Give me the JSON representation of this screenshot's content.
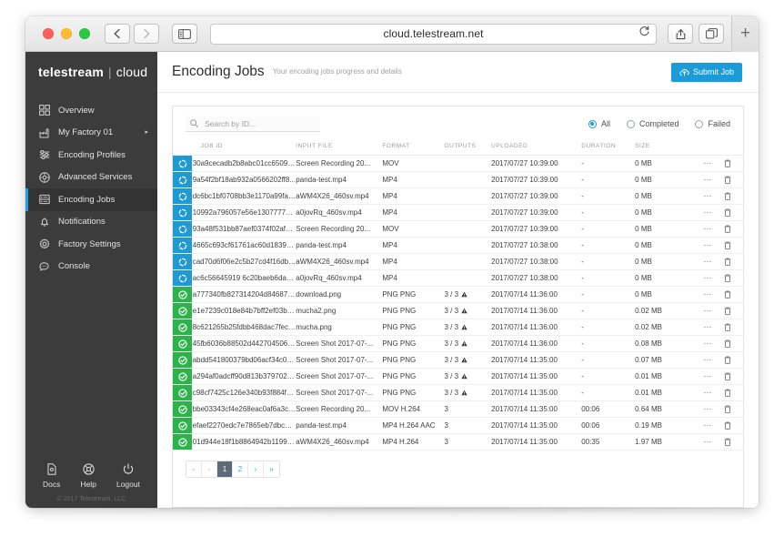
{
  "browser": {
    "url": "cloud.telestream.net",
    "back_label": "‹",
    "forward_label": "›",
    "sidebar_toggle_name": "sidebar-toggle",
    "reload_name": "reload-icon",
    "share_name": "share-icon",
    "tabs_name": "show-tabs-icon",
    "new_tab_label": "+"
  },
  "sidebar": {
    "brand": {
      "part1": "telestream",
      "divider": "|",
      "part2": "cloud"
    },
    "items": [
      {
        "label": "Overview",
        "icon": "grid-icon",
        "active": false,
        "caret": ""
      },
      {
        "label": "My Factory 01",
        "icon": "factory-icon",
        "active": false,
        "caret": "▸"
      },
      {
        "label": "Encoding Profiles",
        "icon": "sliders-icon",
        "active": false,
        "caret": ""
      },
      {
        "label": "Advanced Services",
        "icon": "gear-circle-icon",
        "active": false,
        "caret": ""
      },
      {
        "label": "Encoding Jobs",
        "icon": "server-icon",
        "active": true,
        "caret": ""
      },
      {
        "label": "Notifications",
        "icon": "bell-icon",
        "active": false,
        "caret": ""
      },
      {
        "label": "Factory Settings",
        "icon": "gear-icon",
        "active": false,
        "caret": ""
      },
      {
        "label": "Console",
        "icon": "chat-icon",
        "active": false,
        "caret": ""
      }
    ],
    "footer": [
      {
        "label": "Docs",
        "icon": "docs-icon"
      },
      {
        "label": "Help",
        "icon": "help-icon"
      },
      {
        "label": "Logout",
        "icon": "power-icon"
      }
    ],
    "copyright": "© 2017 Telestream, LLC"
  },
  "header": {
    "title": "Encoding Jobs",
    "subtitle": "Your encoding jobs progress and details",
    "submit_label": "Submit Job",
    "submit_icon": "cloud-upload-icon"
  },
  "filters": {
    "search_placeholder": "Search by ID...",
    "search_value": "",
    "search_icon": "search-icon",
    "radios": [
      {
        "label": "All",
        "selected": true
      },
      {
        "label": "Completed",
        "selected": false
      },
      {
        "label": "Failed",
        "selected": false
      }
    ]
  },
  "table": {
    "columns": [
      "",
      "JOB ID",
      "INPUT FILE",
      "FORMAT",
      "OUTPUTS",
      "UPLOADED",
      "DURATION",
      "SIZE",
      ""
    ],
    "rows": [
      {
        "status": "processing",
        "id": "30a9cecadb2b8abc01cc650928...",
        "input": "Screen Recording 20...",
        "format": "MOV",
        "outputs": "",
        "warn": false,
        "uploaded": "2017/07/27 10:39:00",
        "duration": "-",
        "size": "0 MB"
      },
      {
        "status": "processing",
        "id": "9a54f2bf18ab932a0566202ff8...",
        "input": "panda-test.mp4",
        "format": "MP4",
        "outputs": "",
        "warn": false,
        "uploaded": "2017/07/27 10:39:00",
        "duration": "-",
        "size": "0 MB"
      },
      {
        "status": "processing",
        "id": "dc6bc1bf0708bb3e1170a99fa0...",
        "input": "aWM4X26_460sv.mp4",
        "format": "MP4",
        "outputs": "",
        "warn": false,
        "uploaded": "2017/07/27 10:39:00",
        "duration": "-",
        "size": "0 MB"
      },
      {
        "status": "processing",
        "id": "10992a796057e56e1307777d4...",
        "input": "a0jovRq_460sv.mp4",
        "format": "MP4",
        "outputs": "",
        "warn": false,
        "uploaded": "2017/07/27 10:39:00",
        "duration": "-",
        "size": "0 MB"
      },
      {
        "status": "processing",
        "id": "93a48f531bb87aef0374f02afe0...",
        "input": "Screen Recording 20...",
        "format": "MOV",
        "outputs": "",
        "warn": false,
        "uploaded": "2017/07/27 10:39:00",
        "duration": "-",
        "size": "0 MB"
      },
      {
        "status": "processing",
        "id": "4665c693cf61761ac60d183933...",
        "input": "panda-test.mp4",
        "format": "MP4",
        "outputs": "",
        "warn": false,
        "uploaded": "2017/07/27 10:38:00",
        "duration": "-",
        "size": "0 MB"
      },
      {
        "status": "processing",
        "id": "cad70d6f06e2c5b27cd4f16db2...",
        "input": "aWM4X26_460sv.mp4",
        "format": "MP4",
        "outputs": "",
        "warn": false,
        "uploaded": "2017/07/27 10:38:00",
        "duration": "-",
        "size": "0 MB"
      },
      {
        "status": "processing",
        "id": "ac6c56645919 6c20baeb6da37c...",
        "input": "a0jovRq_460sv.mp4",
        "format": "MP4",
        "outputs": "",
        "warn": false,
        "uploaded": "2017/07/27 10:38:00",
        "duration": "-",
        "size": "0 MB"
      },
      {
        "status": "done",
        "id": "a777340fb827314204d846870...",
        "input": "download.png",
        "format": "PNG PNG",
        "outputs": "3 / 3",
        "warn": true,
        "uploaded": "2017/07/14 11:36:00",
        "duration": "-",
        "size": "0 MB"
      },
      {
        "status": "done",
        "id": "e1e7239c018e84b7bff2ef03b0...",
        "input": "mucha2.png",
        "format": "PNG PNG",
        "outputs": "3 / 3",
        "warn": true,
        "uploaded": "2017/07/14 11:36:00",
        "duration": "-",
        "size": "0.02 MB"
      },
      {
        "status": "done",
        "id": "8c621265b25fdbb468dac7fec7...",
        "input": "mucha.png",
        "format": "PNG PNG",
        "outputs": "3 / 3",
        "warn": true,
        "uploaded": "2017/07/14 11:36:00",
        "duration": "-",
        "size": "0.02 MB"
      },
      {
        "status": "done",
        "id": "45fb6036b88502d4427045069...",
        "input": "Screen Shot 2017-07-...",
        "format": "PNG PNG",
        "outputs": "3 / 3",
        "warn": true,
        "uploaded": "2017/07/14 11:36:00",
        "duration": "-",
        "size": "0.08 MB"
      },
      {
        "status": "done",
        "id": "abdd541800379bd06acf34c0b...",
        "input": "Screen Shot 2017-07-...",
        "format": "PNG PNG",
        "outputs": "3 / 3",
        "warn": true,
        "uploaded": "2017/07/14 11:35:00",
        "duration": "-",
        "size": "0.07 MB"
      },
      {
        "status": "done",
        "id": "a294af0adcff90d813b3797022...",
        "input": "Screen Shot 2017-07-...",
        "format": "PNG PNG",
        "outputs": "3 / 3",
        "warn": true,
        "uploaded": "2017/07/14 11:35:00",
        "duration": "-",
        "size": "0.01 MB"
      },
      {
        "status": "done",
        "id": "c98cf7425c126e340b93f884fc0...",
        "input": "Screen Shot 2017-07-...",
        "format": "PNG PNG",
        "outputs": "3 / 3",
        "warn": true,
        "uploaded": "2017/07/14 11:35:00",
        "duration": "-",
        "size": "0.01 MB"
      },
      {
        "status": "done",
        "id": "bbe03343cf4e268eac0af6a3ce...",
        "input": "Screen Recording 20...",
        "format": "MOV H.264",
        "outputs": "3",
        "warn": false,
        "uploaded": "2017/07/14 11:35:00",
        "duration": "00:06",
        "size": "0.64 MB"
      },
      {
        "status": "done",
        "id": "efaef2270edc7e7865eb7dbc90...",
        "input": "panda-test.mp4",
        "format": "MP4 H.264 AAC",
        "outputs": "3",
        "warn": false,
        "uploaded": "2017/07/14 11:35:00",
        "duration": "00:06",
        "size": "0.19 MB"
      },
      {
        "status": "done",
        "id": "01d944e18f1b8864942b11994f...",
        "input": "aWM4X26_460sv.mp4",
        "format": "MP4 H.264",
        "outputs": "3",
        "warn": false,
        "uploaded": "2017/07/14 11:35:00",
        "duration": "00:35",
        "size": "1.97 MB"
      }
    ],
    "row_action_more": "⋯",
    "row_action_delete": "delete-icon"
  },
  "pagination": {
    "pages": [
      {
        "label": "«",
        "state": "disabled"
      },
      {
        "label": "‹",
        "state": "disabled"
      },
      {
        "label": "1",
        "state": "current"
      },
      {
        "label": "2",
        "state": "normal"
      },
      {
        "label": "›",
        "state": "normal"
      },
      {
        "label": "»",
        "state": "normal"
      }
    ]
  },
  "colors": {
    "accent": "#1b9bd8",
    "processing": "#1e9ad6",
    "done": "#2cb34a",
    "sidebar_bg": "#3c3c3c",
    "sidebar_active": "#333333",
    "active_marker": "#1ba1e2"
  }
}
